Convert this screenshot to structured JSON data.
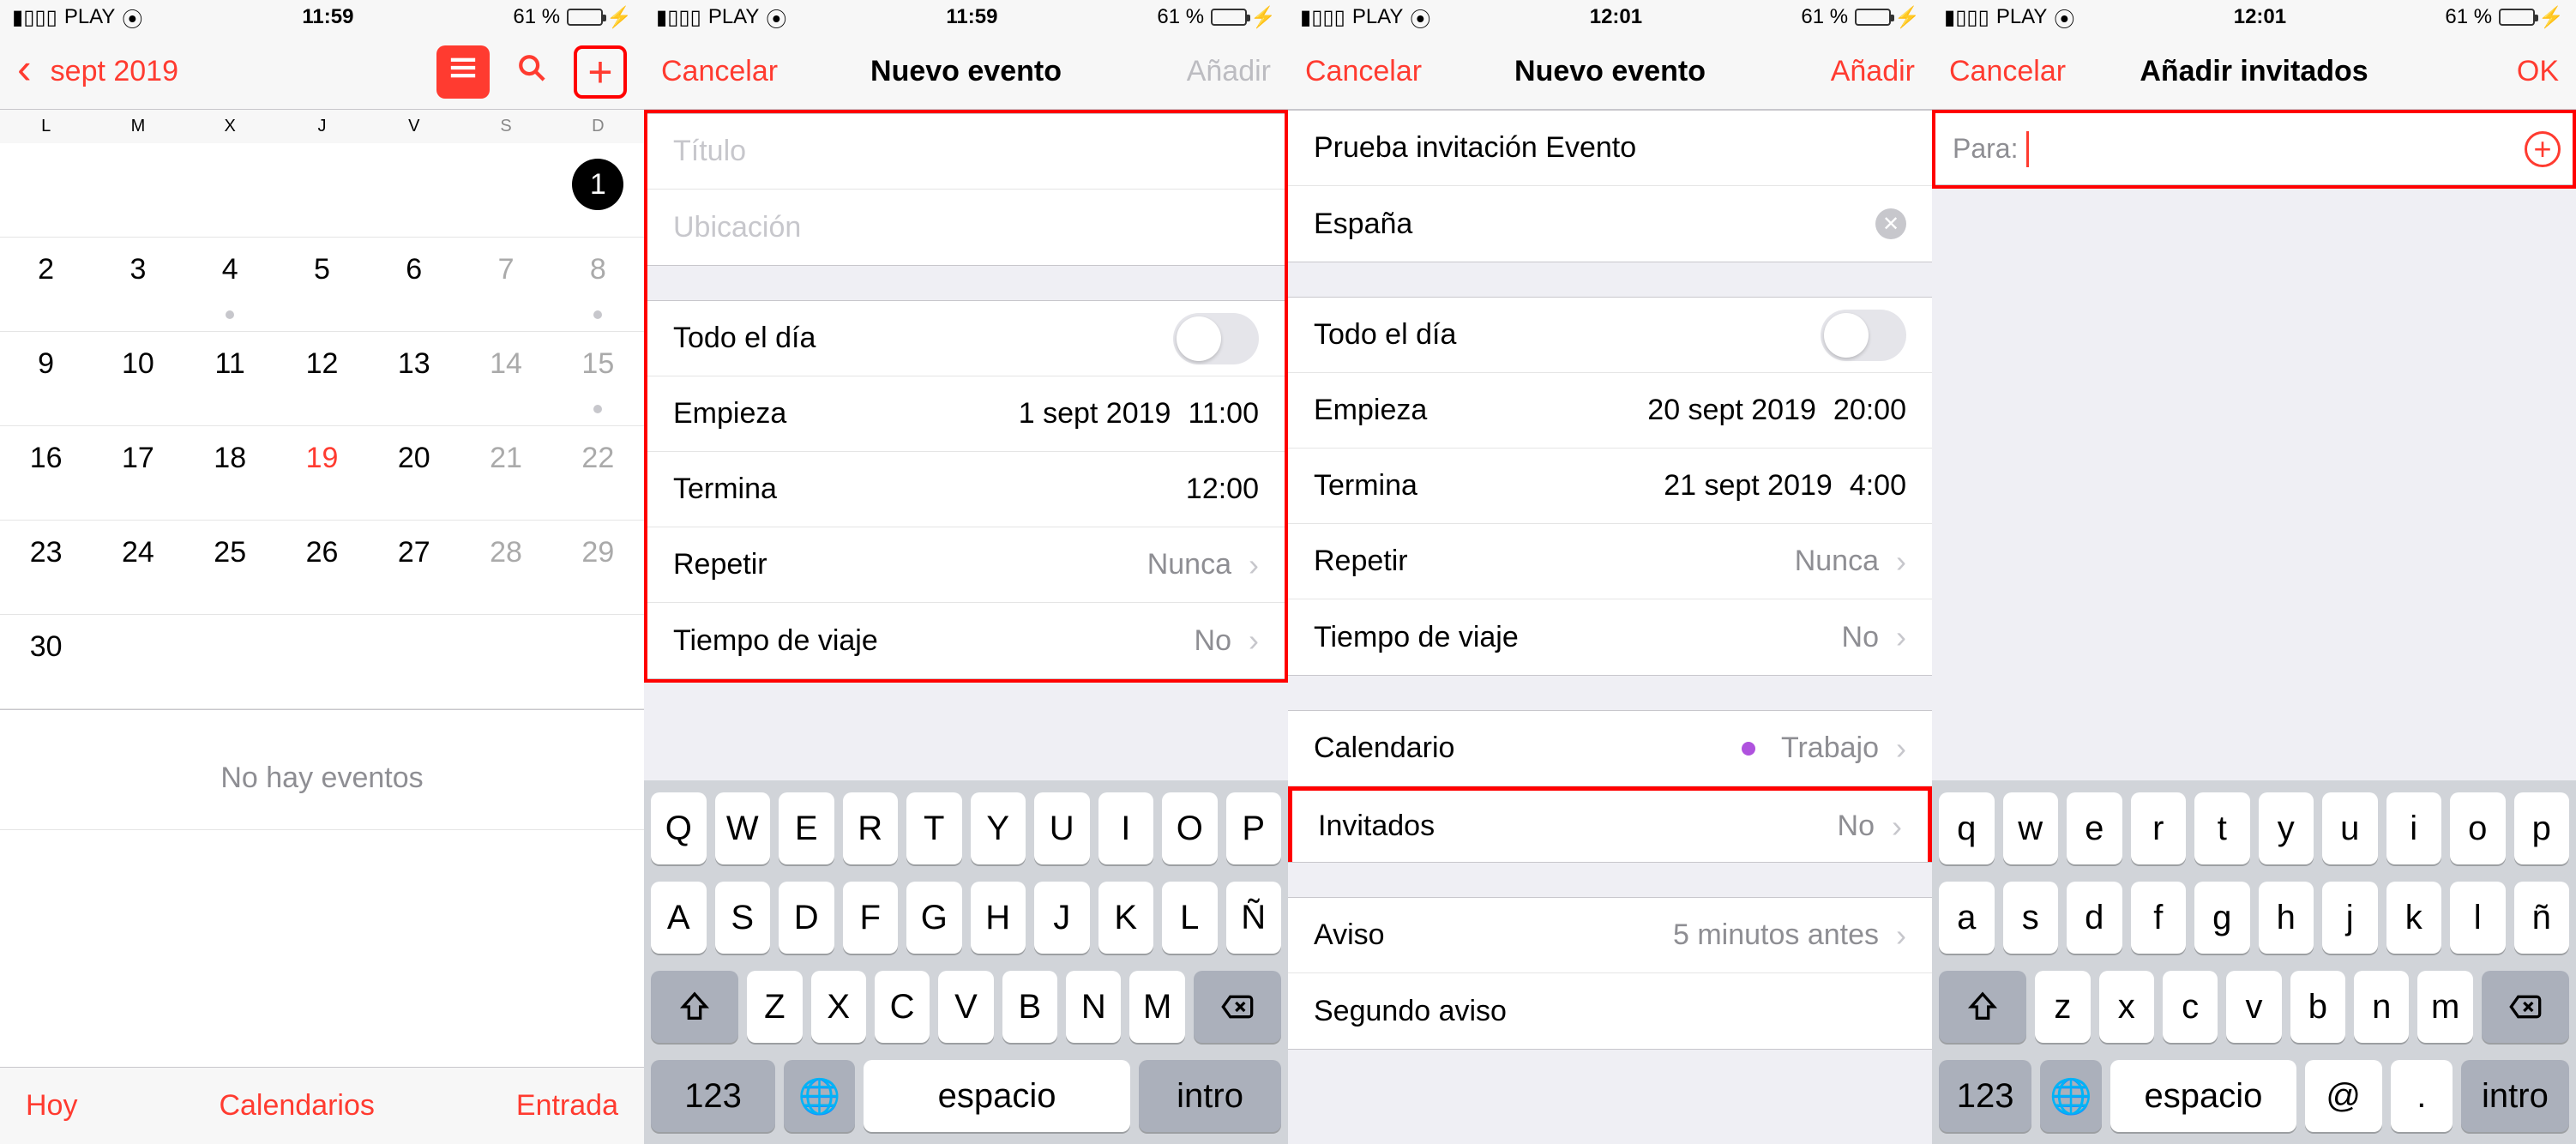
{
  "status": {
    "carrier": "PLAY",
    "time1": "11:59",
    "time2": "12:01",
    "battery_pct": "61 %",
    "battery_fill": 61
  },
  "p1": {
    "back": "sept 2019",
    "weekdays": [
      "L",
      "M",
      "X",
      "J",
      "V",
      "S",
      "D"
    ],
    "grid": [
      [
        "",
        "",
        "",
        "",
        "",
        "",
        {
          "n": "1",
          "sel": true
        }
      ],
      [
        {
          "n": "2"
        },
        {
          "n": "3"
        },
        {
          "n": "4",
          "dot": true
        },
        {
          "n": "5"
        },
        {
          "n": "6"
        },
        {
          "n": "7",
          "wk": true
        },
        {
          "n": "8",
          "wk": true,
          "dot": true
        }
      ],
      [
        {
          "n": "9"
        },
        {
          "n": "10"
        },
        {
          "n": "11"
        },
        {
          "n": "12"
        },
        {
          "n": "13"
        },
        {
          "n": "14",
          "wk": true
        },
        {
          "n": "15",
          "wk": true,
          "dot": true
        }
      ],
      [
        {
          "n": "16"
        },
        {
          "n": "17"
        },
        {
          "n": "18"
        },
        {
          "n": "19",
          "today": true
        },
        {
          "n": "20"
        },
        {
          "n": "21",
          "wk": true
        },
        {
          "n": "22",
          "wk": true
        }
      ],
      [
        {
          "n": "23"
        },
        {
          "n": "24"
        },
        {
          "n": "25"
        },
        {
          "n": "26"
        },
        {
          "n": "27"
        },
        {
          "n": "28",
          "wk": true
        },
        {
          "n": "29",
          "wk": true
        }
      ],
      [
        {
          "n": "30"
        },
        "",
        "",
        "",
        "",
        "",
        ""
      ]
    ],
    "empty": "No hay eventos",
    "toolbar": {
      "today": "Hoy",
      "calendars": "Calendarios",
      "inbox": "Entrada"
    }
  },
  "p2": {
    "cancel": "Cancelar",
    "title": "Nuevo evento",
    "add": "Añadir",
    "f_title": "Título",
    "f_location": "Ubicación",
    "allday": "Todo el día",
    "starts": "Empieza",
    "starts_d": "1 sept 2019",
    "starts_t": "11:00",
    "ends": "Termina",
    "ends_t": "12:00",
    "repeat": "Repetir",
    "repeat_v": "Nunca",
    "travel": "Tiempo de viaje",
    "travel_v": "No",
    "kb_r1": [
      "Q",
      "W",
      "E",
      "R",
      "T",
      "Y",
      "U",
      "I",
      "O",
      "P"
    ],
    "kb_r2": [
      "A",
      "S",
      "D",
      "F",
      "G",
      "H",
      "J",
      "K",
      "L",
      "Ñ"
    ],
    "kb_r3": [
      "Z",
      "X",
      "C",
      "V",
      "B",
      "N",
      "M"
    ],
    "kb_123": "123",
    "kb_space": "espacio",
    "kb_enter": "intro"
  },
  "p3": {
    "cancel": "Cancelar",
    "title": "Nuevo evento",
    "add": "Añadir",
    "f_title": "Prueba invitación Evento",
    "f_location": "España",
    "allday": "Todo el día",
    "starts": "Empieza",
    "starts_d": "20 sept 2019",
    "starts_t": "20:00",
    "ends": "Termina",
    "ends_d": "21 sept 2019",
    "ends_t": "4:00",
    "repeat": "Repetir",
    "repeat_v": "Nunca",
    "travel": "Tiempo de viaje",
    "travel_v": "No",
    "calendar": "Calendario",
    "calendar_v": "Trabajo",
    "invitees": "Invitados",
    "invitees_v": "No",
    "alert": "Aviso",
    "alert_v": "5 minutos antes",
    "alert2": "Segundo aviso"
  },
  "p4": {
    "cancel": "Cancelar",
    "title": "Añadir invitados",
    "ok": "OK",
    "to": "Para:",
    "kb_r1": [
      "q",
      "w",
      "e",
      "r",
      "t",
      "y",
      "u",
      "i",
      "o",
      "p"
    ],
    "kb_r2": [
      "a",
      "s",
      "d",
      "f",
      "g",
      "h",
      "j",
      "k",
      "l",
      "ñ"
    ],
    "kb_r3": [
      "z",
      "x",
      "c",
      "v",
      "b",
      "n",
      "m"
    ],
    "kb_123": "123",
    "kb_space": "espacio",
    "kb_at": "@",
    "kb_dot": ".",
    "kb_enter": "intro"
  }
}
